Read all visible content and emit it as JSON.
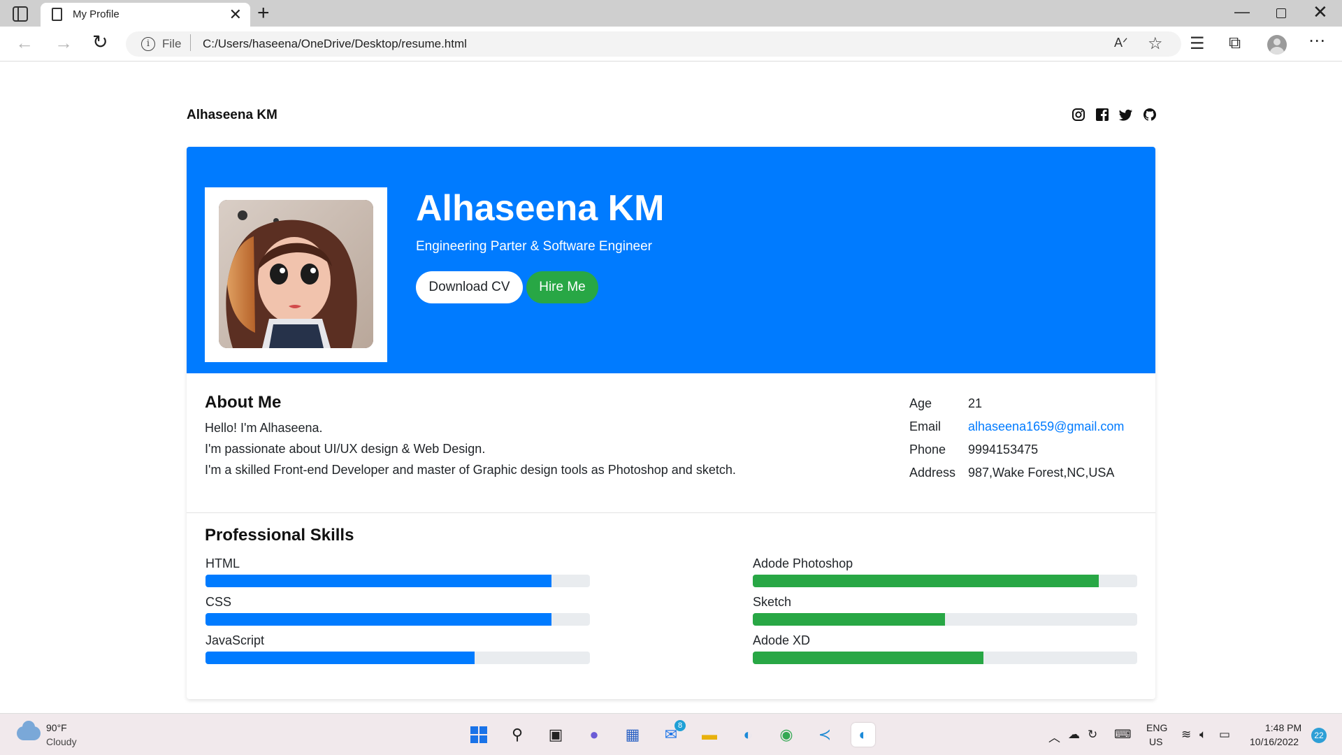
{
  "browser": {
    "tab_title": "My Profile",
    "tab_close": "✕",
    "new_tab": "+",
    "address_scheme": "File",
    "address_url": "C:/Users/haseena/OneDrive/Desktop/resume.html",
    "window_min": "—",
    "window_close": "✕"
  },
  "site": {
    "name": "Alhaseena KM",
    "social_icons": [
      "instagram-icon",
      "facebook-icon",
      "twitter-icon",
      "github-icon"
    ]
  },
  "hero": {
    "name": "Alhaseena KM",
    "role": "Engineering Parter & Software Engineer",
    "download_label": "Download CV",
    "hire_label": "Hire Me",
    "accent_color": "#007bff",
    "hire_color": "#28a745"
  },
  "about": {
    "title": "About Me",
    "lines": [
      "Hello! I'm Alhaseena.",
      "I'm passionate about UI/UX design & Web Design.",
      "I'm a skilled Front-end Developer and master of Graphic design tools as Photoshop and sketch."
    ],
    "info": [
      {
        "key": "Age",
        "value": "21"
      },
      {
        "key": "Email",
        "value": "alhaseena1659@gmail.com"
      },
      {
        "key": "Phone",
        "value": "9994153475"
      },
      {
        "key": "Address",
        "value": "987,Wake Forest,NC,USA"
      }
    ]
  },
  "skills": {
    "title": "Professional Skills",
    "left": [
      {
        "label": "HTML",
        "level": 0.9,
        "color": "#007bff"
      },
      {
        "label": "CSS",
        "level": 0.9,
        "color": "#007bff"
      },
      {
        "label": "JavaScript",
        "level": 0.7,
        "color": "#007bff"
      }
    ],
    "right": [
      {
        "label": "Adode Photoshop",
        "level": 0.9,
        "color": "#28a745"
      },
      {
        "label": "Sketch",
        "level": 0.5,
        "color": "#28a745"
      },
      {
        "label": "Adode XD",
        "level": 0.6,
        "color": "#28a745"
      }
    ]
  },
  "taskbar": {
    "weather_temp": "90°F",
    "weather_cond": "Cloudy",
    "mail_badge": "8",
    "lang_line1": "ENG",
    "lang_line2": "US",
    "time": "1:48 PM",
    "date": "10/16/2022",
    "notifications": "22"
  }
}
